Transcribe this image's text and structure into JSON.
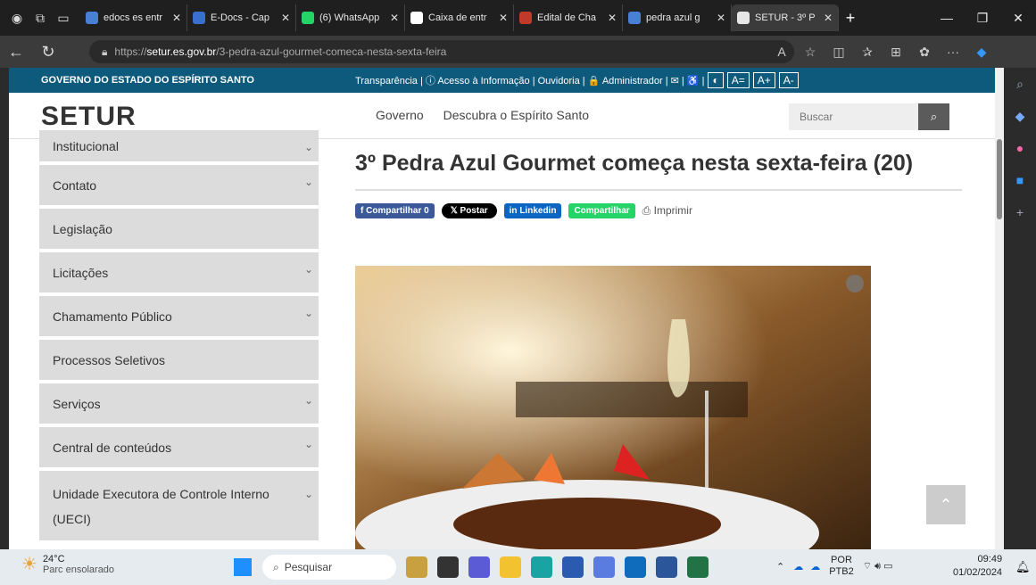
{
  "browser": {
    "tabs": [
      {
        "label": "edocs es entr",
        "fav": "search",
        "color": "#4a7fd6"
      },
      {
        "label": "E-Docs - Cap",
        "fav": "E",
        "color": "#3a6fd0"
      },
      {
        "label": "(6) WhatsApp",
        "fav": "wa",
        "color": "#25d366"
      },
      {
        "label": "Caixa de entr",
        "fav": "M",
        "color": "#ffffff"
      },
      {
        "label": "Edital de Cha",
        "fav": "pdf",
        "color": "#c0392b"
      },
      {
        "label": "pedra azul g",
        "fav": "search",
        "color": "#4a7fd6"
      },
      {
        "label": "SETUR - 3º P",
        "fav": "flag",
        "color": "#e7e7e7"
      }
    ],
    "url_prefix": "https://",
    "url_domain": "setur.es.gov.br",
    "url_path": "/3-pedra-azul-gourmet-comeca-nesta-sexta-feira"
  },
  "site": {
    "gov_label": "GOVERNO DO ESTADO DO ESPÍRITO SANTO",
    "top_links": "Transparência | ⓘ Acesso à Informação | Ouvidoria | 🔒 Administrador | ✉ | ♿ |",
    "acc_buttons": [
      "◐",
      "A=",
      "A+",
      "A-"
    ],
    "logo": "SETUR",
    "menu": [
      "Governo",
      "Descubra o Espírito Santo"
    ],
    "search_placeholder": "Buscar"
  },
  "sidebar": {
    "items": [
      {
        "label": "Institucional",
        "chevron": true
      },
      {
        "label": "Contato",
        "chevron": true
      },
      {
        "label": "Legislação",
        "chevron": false
      },
      {
        "label": "Licitações",
        "chevron": true
      },
      {
        "label": "Chamamento Público",
        "chevron": true
      },
      {
        "label": "Processos Seletivos",
        "chevron": false
      },
      {
        "label": "Serviços",
        "chevron": true
      },
      {
        "label": "Central de conteúdos",
        "chevron": true
      },
      {
        "label": "Unidade Executora de Controle Interno (UECI)",
        "chevron": true
      }
    ]
  },
  "article": {
    "title": "3º Pedra Azul Gourmet começa nesta sexta-feira (20)",
    "share": {
      "facebook": "f Compartilhar 0",
      "x": "𝕏 Postar",
      "linkedin": "in Linkedin",
      "whatsapp": "Compartilhar",
      "print": "Imprimir"
    }
  },
  "taskbar": {
    "temp": "24°C",
    "weather": "Parc ensolarado",
    "search": "Pesquisar",
    "lang1": "POR",
    "lang2": "PTB2",
    "time": "09:49",
    "date": "01/02/2024"
  }
}
